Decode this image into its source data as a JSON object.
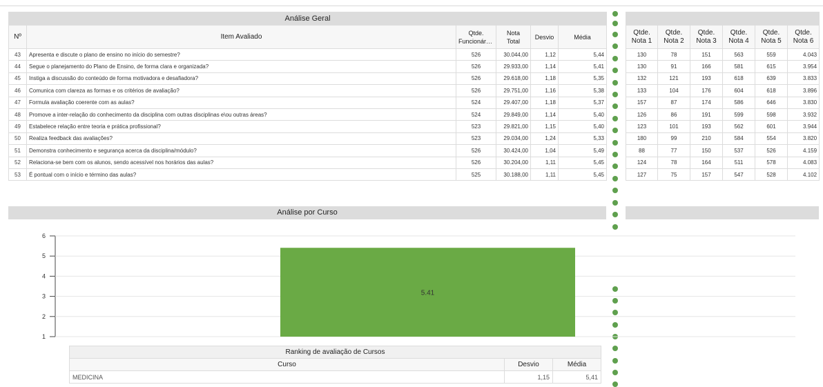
{
  "main": {
    "title": "Análise Geral",
    "headers": {
      "num": "Nº",
      "item": "Item Avaliado",
      "qtde": "Qtde.",
      "qtde2": "Funcionários",
      "nota": "Nota",
      "nota2": "Total",
      "desvio": "Desvio",
      "media": "Média"
    },
    "rows": [
      {
        "n": "43",
        "item": "Apresenta e discute o plano de ensino no início do semestre?",
        "qtde": "526",
        "nota": "30.044,00",
        "desvio": "1,12",
        "media": "5,44"
      },
      {
        "n": "44",
        "item": "Segue o planejamento do Plano de Ensino, de forma clara e organizada?",
        "qtde": "526",
        "nota": "29.933,00",
        "desvio": "1,14",
        "media": "5,41"
      },
      {
        "n": "45",
        "item": "Instiga a discussão do conteúdo de forma motivadora e desafiadora?",
        "qtde": "526",
        "nota": "29.618,00",
        "desvio": "1,18",
        "media": "5,35"
      },
      {
        "n": "46",
        "item": "Comunica com clareza as formas e os critérios de avaliação?",
        "qtde": "526",
        "nota": "29.751,00",
        "desvio": "1,16",
        "media": "5,38"
      },
      {
        "n": "47",
        "item": "Formula avaliação coerente com as aulas?",
        "qtde": "524",
        "nota": "29.407,00",
        "desvio": "1,18",
        "media": "5,37"
      },
      {
        "n": "48",
        "item": "Promove a inter-relação do conhecimento da disciplina com outras disciplinas e\\ou outras áreas?",
        "qtde": "524",
        "nota": "29.849,00",
        "desvio": "1,14",
        "media": "5,40"
      },
      {
        "n": "49",
        "item": "Estabelece relação entre teoria e prática profissional?",
        "qtde": "523",
        "nota": "29.821,00",
        "desvio": "1,15",
        "media": "5,40"
      },
      {
        "n": "50",
        "item": "Realiza feedback das avaliações?",
        "qtde": "523",
        "nota": "29.034,00",
        "desvio": "1,24",
        "media": "5,33"
      },
      {
        "n": "51",
        "item": "Demonstra conhecimento e segurança acerca da disciplina/módulo?",
        "qtde": "526",
        "nota": "30.424,00",
        "desvio": "1,04",
        "media": "5,49"
      },
      {
        "n": "52",
        "item": "Relaciona-se bem com os alunos, sendo acessível nos horários das aulas?",
        "qtde": "526",
        "nota": "30.204,00",
        "desvio": "1,11",
        "media": "5,45"
      },
      {
        "n": "53",
        "item": "É pontual com o início e término das aulas?",
        "qtde": "525",
        "nota": "30.188,00",
        "desvio": "1,11",
        "media": "5,45"
      }
    ]
  },
  "right": {
    "headers": [
      {
        "a": "Qtde.",
        "b": "Nota 1"
      },
      {
        "a": "Qtde.",
        "b": "Nota 2"
      },
      {
        "a": "Qtde.",
        "b": "Nota 3"
      },
      {
        "a": "Qtde.",
        "b": "Nota 4"
      },
      {
        "a": "Qtde.",
        "b": "Nota 5"
      },
      {
        "a": "Qtde.",
        "b": "Nota 6"
      }
    ],
    "rows": [
      [
        "130",
        "78",
        "151",
        "563",
        "559",
        "4.043"
      ],
      [
        "130",
        "91",
        "166",
        "581",
        "615",
        "3.954"
      ],
      [
        "132",
        "121",
        "193",
        "618",
        "639",
        "3.833"
      ],
      [
        "133",
        "104",
        "176",
        "604",
        "618",
        "3.896"
      ],
      [
        "157",
        "87",
        "174",
        "586",
        "646",
        "3.830"
      ],
      [
        "126",
        "86",
        "191",
        "599",
        "598",
        "3.932"
      ],
      [
        "123",
        "101",
        "193",
        "562",
        "601",
        "3.944"
      ],
      [
        "180",
        "99",
        "210",
        "584",
        "554",
        "3.820"
      ],
      [
        "88",
        "77",
        "150",
        "537",
        "526",
        "4.159"
      ],
      [
        "124",
        "78",
        "164",
        "511",
        "578",
        "4.083"
      ],
      [
        "127",
        "75",
        "157",
        "547",
        "528",
        "4.102"
      ]
    ]
  },
  "course_section": {
    "title": "Análise por Curso"
  },
  "chart_data": {
    "type": "bar",
    "categories": [
      "MEDICINA"
    ],
    "values": [
      5.41
    ],
    "data_labels": [
      "5.41"
    ],
    "ylim": [
      1,
      6
    ],
    "yticks": [
      "1",
      "2",
      "3",
      "4",
      "5",
      "6"
    ],
    "bar_color": "#6aaa45",
    "grid": true,
    "legend": "none"
  },
  "ranking": {
    "title": "Ranking de avaliação de Cursos",
    "headers": {
      "curso": "Curso",
      "desvio": "Desvio",
      "media": "Média"
    },
    "rows": [
      {
        "curso": "MEDICINA",
        "desvio": "1,15",
        "media": "5,41"
      }
    ]
  },
  "colors": {
    "accent_green": "#5fa04e",
    "header_grey": "#dcdcdc"
  }
}
